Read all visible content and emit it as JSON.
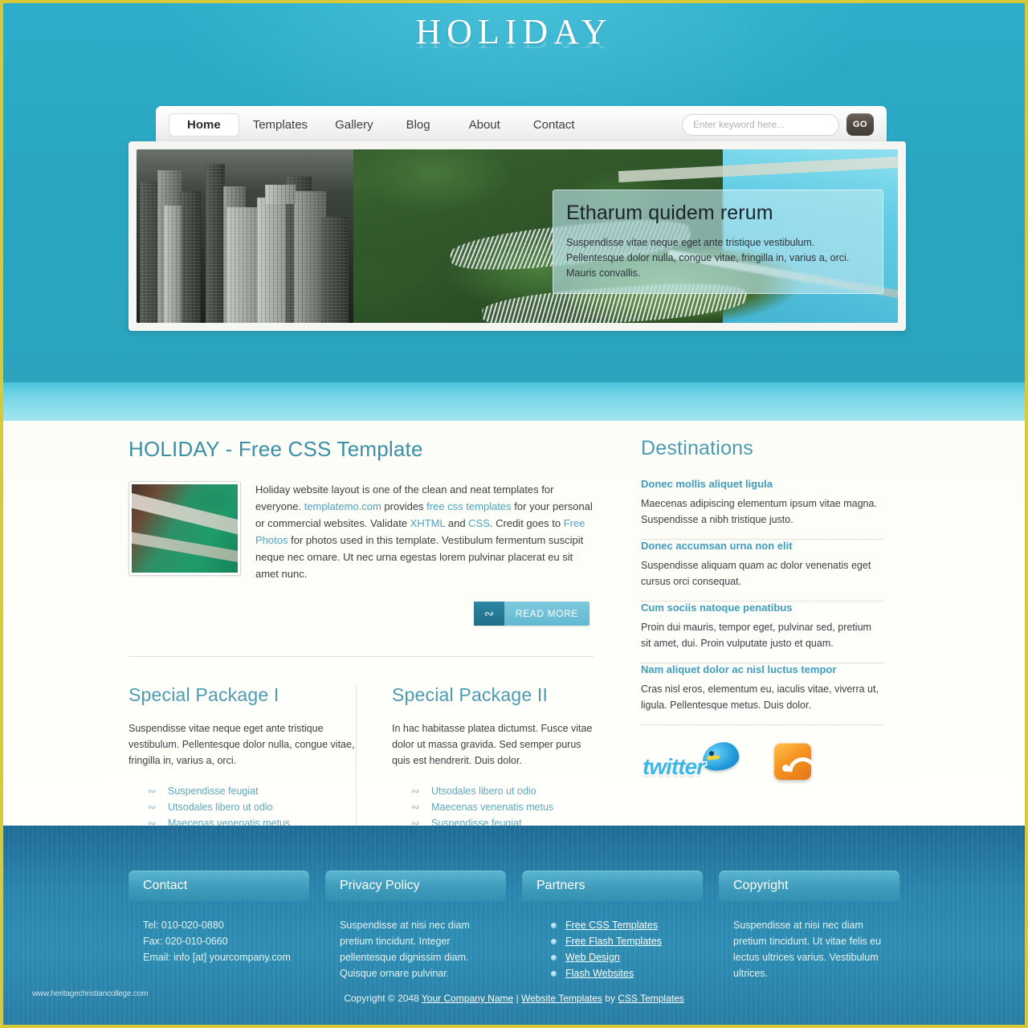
{
  "site": {
    "logo": "HOLIDAY"
  },
  "nav": {
    "items": [
      {
        "label": "Home",
        "active": true
      },
      {
        "label": "Templates",
        "active": false
      },
      {
        "label": "Gallery",
        "active": false
      },
      {
        "label": "Blog",
        "active": false
      },
      {
        "label": "About",
        "active": false
      },
      {
        "label": "Contact",
        "active": false
      }
    ],
    "search_placeholder": "Enter keyword here...",
    "go_label": "GO"
  },
  "hero": {
    "title": "Etharum quidem rerum",
    "text": "Suspendisse vitae neque eget ante tristique vestibulum. Pellentesque dolor nulla, congue vitae, fringilla in, varius a, orci. Mauris convallis.",
    "image_alt": "aerial-view-of-city-lakefront-and-harbor"
  },
  "main": {
    "title": "HOLIDAY - Free CSS Template",
    "thumb_alt": "aerial-view-of-green-parkland",
    "intro_parts": {
      "p1": "Holiday website layout is one of the clean and neat templates for everyone. ",
      "link1": "templatemo.com",
      "p2": " provides ",
      "link2": "free css templates",
      "p3": " for your personal or commercial websites. Validate ",
      "link3": "XHTML",
      "p4": " and ",
      "link4": "CSS",
      "p5": ". Credit goes to ",
      "link5": "Free Photos",
      "p6": " for photos used in this template. Vestibulum fermentum suscipit neque nec ornare. Ut nec urna egestas lorem pulvinar placerat eu sit amet nunc."
    },
    "read_more": "READ MORE",
    "read_more_icon": "swirl-icon"
  },
  "packages": [
    {
      "title": "Special Package I",
      "text": "Suspendisse vitae neque eget ante tristique vestibulum. Pellentesque dolor nulla, congue vitae, fringilla in, varius a, orci.",
      "links": [
        "Suspendisse feugiat",
        "Utsodales libero ut odio",
        "Maecenas venenatis metus"
      ]
    },
    {
      "title": "Special Package II",
      "text": "In hac habitasse platea dictumst. Fusce vitae dolor ut massa gravida. Sed semper purus quis est hendrerit. Duis dolor.",
      "links": [
        "Utsodales libero ut odio",
        "Maecenas venenatis metus",
        "Suspendisse feugiat"
      ]
    }
  ],
  "sidebar": {
    "title": "Destinations",
    "items": [
      {
        "heading": "Donec mollis aliquet ligula",
        "text": "Maecenas adipiscing elementum ipsum vitae magna. Suspendisse a nibh tristique justo."
      },
      {
        "heading": "Donec accumsan urna non elit",
        "text": "Suspendisse aliquam quam ac dolor venenatis eget cursus orci consequat."
      },
      {
        "heading": "Cum sociis natoque penatibus",
        "text": "Proin dui mauris, tempor eget, pulvinar sed, pretium sit amet, dui. Proin vulputate justo et quam."
      },
      {
        "heading": "Nam aliquet dolor ac nisl luctus tempor",
        "text": "Cras nisl eros, elementum eu, iaculis vitae, viverra ut, ligula. Pellentesque metus. Duis dolor."
      }
    ],
    "social": {
      "twitter_label": "twitter",
      "twitter_icon": "twitter-bird-icon",
      "rss_icon": "rss-feed-icon"
    }
  },
  "footer": {
    "columns": [
      {
        "title": "Contact",
        "type": "text",
        "lines": [
          "Tel: 010-020-0880",
          "Fax: 020-010-0660",
          "Email: info [at] yourcompany.com"
        ]
      },
      {
        "title": "Privacy Policy",
        "type": "paragraph",
        "text": "Suspendisse at nisi nec diam pretium tincidunt. Integer pellentesque dignissim diam. Quisque ornare pulvinar."
      },
      {
        "title": "Partners",
        "type": "links",
        "links": [
          "Free CSS Templates",
          "Free Flash Templates",
          "Web Design",
          "Flash Websites"
        ]
      },
      {
        "title": "Copyright",
        "type": "paragraph",
        "text": "Suspendisse at nisi nec diam pretium tincidunt. Ut vitae felis eu lectus ultrices varius. Vestibulum ultrices."
      }
    ],
    "copyright": {
      "prefix": "Copyright © 2048 ",
      "company": "Your Company Name",
      "sep": " | ",
      "link1": "Website Templates",
      "by": " by ",
      "link2": "CSS Templates"
    },
    "watermark": "www.heritagechristiancollege.com"
  },
  "colors": {
    "accent": "#3f9dbd",
    "page_bg": "#2aa8c4",
    "border": "#d8c93a",
    "footer": "#2b86ad"
  }
}
